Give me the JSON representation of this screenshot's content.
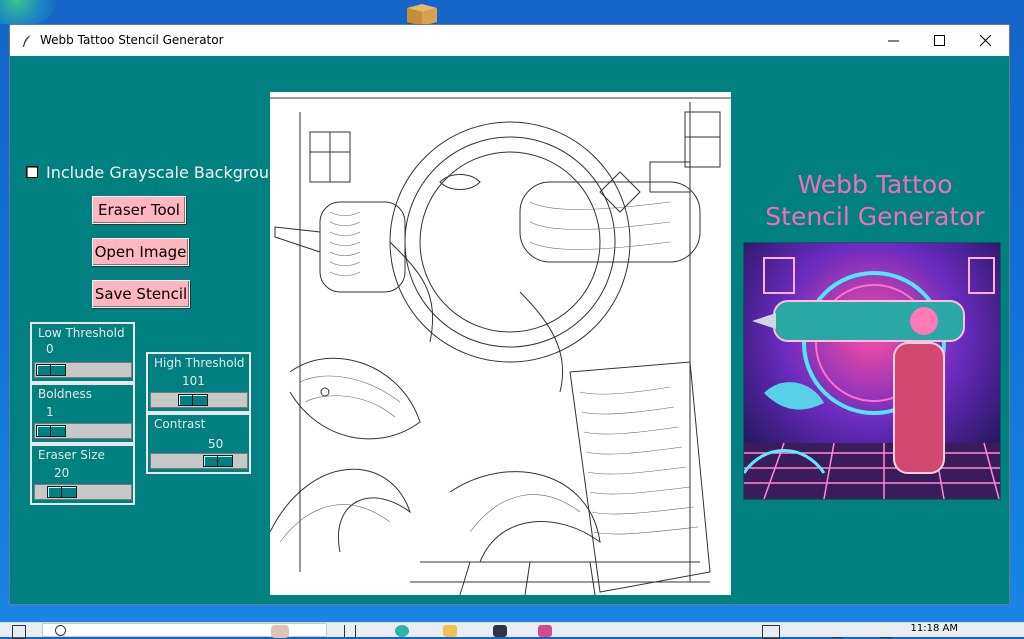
{
  "window": {
    "title": "Webb Tattoo Stencil Generator",
    "bg_color": "#008080"
  },
  "controls": {
    "grayscale_label": "Include Grayscale Background",
    "grayscale_checked": false,
    "eraser_label": "Eraser Tool",
    "open_label": "Open Image",
    "save_label": "Save Stencil",
    "button_color": "#ffb6c1"
  },
  "sliders": {
    "low_threshold": {
      "label": "Low Threshold",
      "value": "0"
    },
    "boldness": {
      "label": "Boldness",
      "value": "1"
    },
    "eraser_size": {
      "label": "Eraser Size",
      "value": "20"
    },
    "high_threshold": {
      "label": "High Threshold",
      "value": "101"
    },
    "contrast": {
      "label": "Contrast",
      "value": "50"
    }
  },
  "side": {
    "title": "Webb Tattoo\nStencil Generator",
    "title_color": "#f06fb4"
  },
  "taskbar": {
    "time": "11:18 AM"
  },
  "icons": [
    "feather-icon",
    "minimize-icon",
    "maximize-icon",
    "close-icon",
    "checkbox-icon",
    "search-icon",
    "taskview-icon",
    "edge-icon",
    "explorer-icon",
    "store-icon",
    "app-icon"
  ]
}
